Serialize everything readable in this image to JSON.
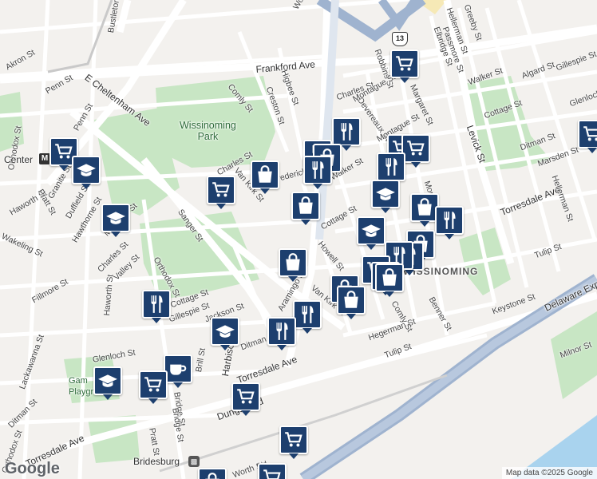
{
  "map": {
    "attribution": "Map data ©2025 Google",
    "logo": "Google",
    "route_shield": "13",
    "neighborhood": "WISSINOMING",
    "park_lines": [
      "Wissinoming",
      "Park"
    ],
    "playground_lines": [
      "Gam",
      "Playgr"
    ],
    "center_label": "Center",
    "rail_station_label": "Bridesburg",
    "colors": {
      "pin": "#1d3f6e",
      "park": "#c8e6c4",
      "highway": "#9fb3cf",
      "water": "#a9d3ee",
      "land": "#f3f1ee"
    }
  },
  "street_labels": [
    "Bustleton Ave",
    "Akron St",
    "Penn St",
    "Frankford Ave",
    "E Cheltenham Ave",
    "Comly St",
    "Higbee St",
    "Creston St",
    "Charles St",
    "Devereaux St",
    "Greeby St",
    "Hellerman St",
    "Passmore St",
    "Elbridge St",
    "Robbins St",
    "Walker St",
    "Algard St",
    "Gillespie St",
    "Glenloch St",
    "Cottage St",
    "Levick St",
    "Ditman St",
    "Marsden St",
    "Torresdale Ave",
    "Hellerman St",
    "Keystone St",
    "Tulip St",
    "Delaware Expy",
    "Milnor St",
    "Benner St",
    "Hegerman St",
    "Comly St",
    "Van Kirk St",
    "Howell St",
    "Cottage St",
    "Walker St",
    "Frederick St",
    "Van Kirk St",
    "Charles St",
    "Sanger St",
    "Mulberry St",
    "Charles St",
    "Valley St",
    "Haworth St",
    "Wakeling St",
    "Hawthorne St",
    "Duffield St",
    "Granite St",
    "Pratt St",
    "Orthodox St",
    "Haworth St",
    "Fillmore St",
    "Gillespie St",
    "Cottage St",
    "Jackson St",
    "Ditman St",
    "Glenloch St",
    "Brill St",
    "Harbison Ave",
    "Torresdale Ave",
    "Tulip St",
    "Pratt St",
    "Bridge St",
    "Lackawanna St",
    "Ditman St",
    "Torresdale Ave",
    "Orthodox St",
    "Dungan Rd",
    "Orthodox St",
    "Aramingo St",
    "Worth St",
    "Worth St",
    "Penn St",
    "Montague St",
    "Montague St",
    "Margaret St",
    "Rd",
    "Mortimer St",
    "Bridge St"
  ],
  "markers": [
    {
      "id": "m1",
      "type": "grocery-icon"
    },
    {
      "id": "m2",
      "type": "grocery-icon"
    },
    {
      "id": "m3",
      "type": "school-icon"
    },
    {
      "id": "m4",
      "type": "school-icon"
    },
    {
      "id": "m5",
      "type": "grocery-icon"
    },
    {
      "id": "m6",
      "type": "shopping-bag-icon"
    },
    {
      "id": "m7",
      "type": "restaurant-icon"
    },
    {
      "id": "m8",
      "type": "restaurant-icon"
    },
    {
      "id": "m9",
      "type": "shopping-bag-icon"
    },
    {
      "id": "m10",
      "type": "restaurant-icon"
    },
    {
      "id": "m11",
      "type": "shopping-bag-icon"
    },
    {
      "id": "m12",
      "type": "grocery-icon"
    },
    {
      "id": "m13",
      "type": "grocery-icon"
    },
    {
      "id": "m14",
      "type": "restaurant-icon"
    },
    {
      "id": "m15",
      "type": "school-icon"
    },
    {
      "id": "m16",
      "type": "shopping-bag-icon"
    },
    {
      "id": "m17",
      "type": "restaurant-icon"
    },
    {
      "id": "m18",
      "type": "school-icon"
    },
    {
      "id": "m19",
      "type": "shopping-bag-icon"
    },
    {
      "id": "m20",
      "type": "restaurant-icon"
    },
    {
      "id": "m21",
      "type": "restaurant-icon"
    },
    {
      "id": "m22",
      "type": "grocery-icon"
    },
    {
      "id": "m23",
      "type": "shopping-bag-icon"
    },
    {
      "id": "m24",
      "type": "shopping-bag-icon"
    },
    {
      "id": "m25",
      "type": "shopping-bag-icon"
    },
    {
      "id": "m26",
      "type": "restaurant-icon"
    },
    {
      "id": "m27",
      "type": "restaurant-icon"
    },
    {
      "id": "m28",
      "type": "restaurant-icon"
    },
    {
      "id": "m29",
      "type": "school-icon"
    },
    {
      "id": "m30",
      "type": "cafe-icon"
    },
    {
      "id": "m31",
      "type": "school-icon"
    },
    {
      "id": "m32",
      "type": "grocery-icon"
    },
    {
      "id": "m33",
      "type": "grocery-icon"
    },
    {
      "id": "m34",
      "type": "grocery-icon"
    },
    {
      "id": "m35",
      "type": "shopping-bag-icon"
    },
    {
      "id": "m36",
      "type": "grocery-icon"
    },
    {
      "id": "m37",
      "type": "shopping-bag-icon"
    },
    {
      "id": "m38",
      "type": "restaurant-icon"
    },
    {
      "id": "m39",
      "type": "shopping-bag-icon"
    },
    {
      "id": "m40",
      "type": "grocery-icon"
    }
  ]
}
